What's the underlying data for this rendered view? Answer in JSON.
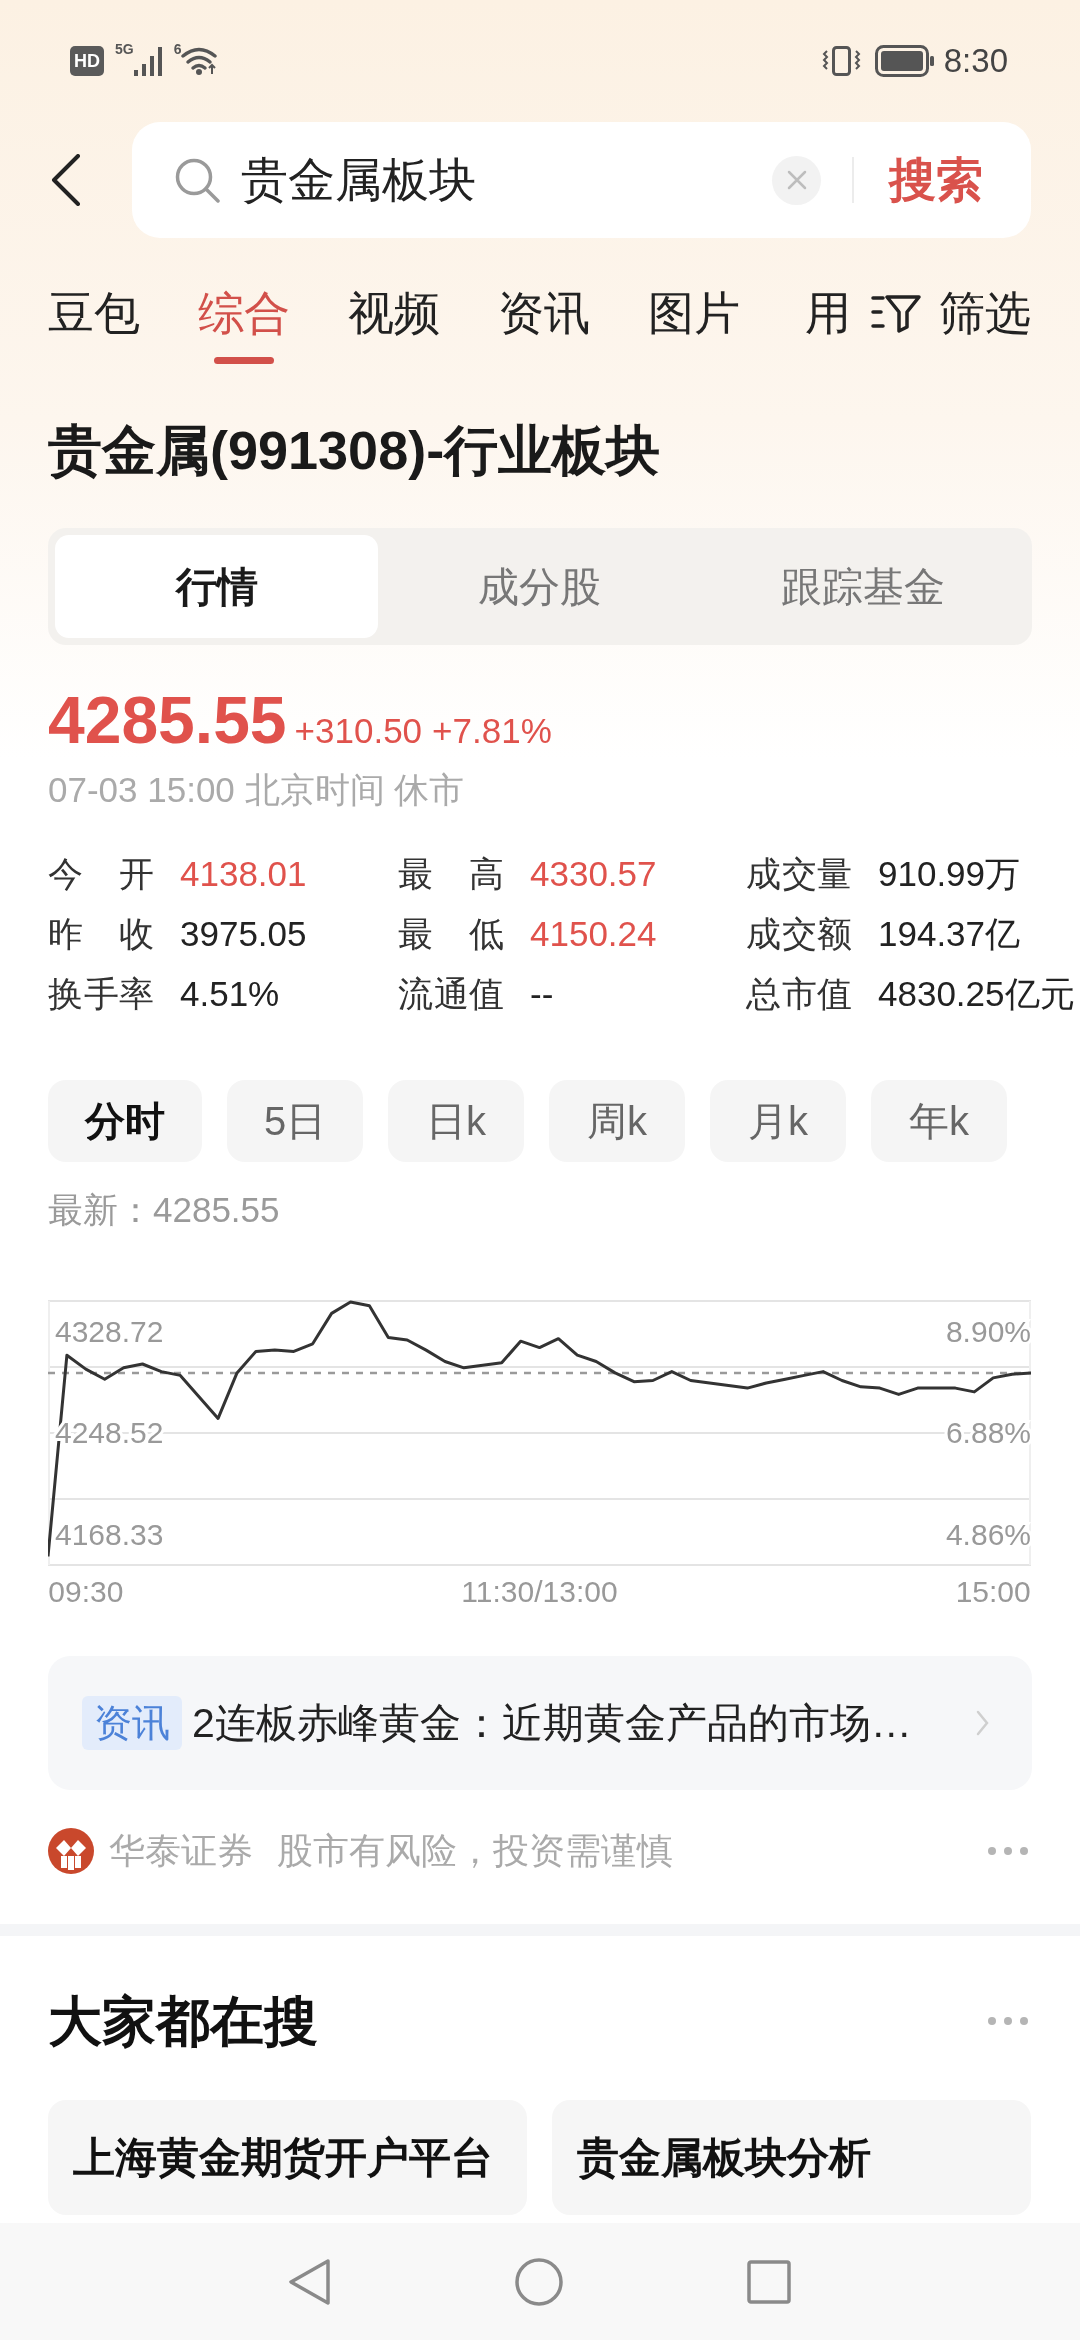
{
  "status_bar": {
    "network_badge": "HD",
    "signal_label": "5G",
    "wifi_label": "6",
    "time": "8:30"
  },
  "search": {
    "value": "贵金属板块",
    "button": "搜索"
  },
  "tabs": [
    {
      "label": "豆包",
      "selected": false
    },
    {
      "label": "综合",
      "selected": true
    },
    {
      "label": "视频",
      "selected": false
    },
    {
      "label": "资讯",
      "selected": false
    },
    {
      "label": "图片",
      "selected": false
    },
    {
      "label": "用",
      "selected": false
    }
  ],
  "filter": {
    "label": "筛选"
  },
  "title": "贵金属(991308)-行业板块",
  "segments": [
    {
      "label": "行情",
      "selected": true
    },
    {
      "label": "成分股",
      "selected": false
    },
    {
      "label": "跟踪基金",
      "selected": false
    }
  ],
  "quote": {
    "price": "4285.55",
    "change": "+310.50",
    "change_percent": "+7.81%",
    "time": "07-03 15:00 北京时间 休市"
  },
  "stats": [
    {
      "cells": [
        {
          "label": "今 开",
          "value": "4138.01",
          "color": "#e0524c"
        },
        {
          "label": "最 高",
          "value": "4330.57",
          "color": "#e0524c"
        },
        {
          "label": "成交量",
          "value": "910.99万",
          "color": "#222222"
        }
      ]
    },
    {
      "cells": [
        {
          "label": "昨 收",
          "value": "3975.05",
          "color": "#222222"
        },
        {
          "label": "最 低",
          "value": "4150.24",
          "color": "#e0524c"
        },
        {
          "label": "成交额",
          "value": "194.37亿",
          "color": "#222222"
        }
      ]
    },
    {
      "cells": [
        {
          "label": "换手率",
          "value": "4.51%",
          "color": "#222222"
        },
        {
          "label": "流通值",
          "value": "--",
          "color": "#222222"
        },
        {
          "label": "总市值",
          "value": "4830.25亿元",
          "color": "#222222"
        }
      ]
    }
  ],
  "periods": [
    {
      "label": "分时",
      "selected": true
    },
    {
      "label": "5日",
      "selected": false
    },
    {
      "label": "日k",
      "selected": false
    },
    {
      "label": "周k",
      "selected": false
    },
    {
      "label": "月k",
      "selected": false
    },
    {
      "label": "年k",
      "selected": false
    }
  ],
  "chart": {
    "latest": "最新：4285.55",
    "right_axis_labels": [
      "8.90%",
      "6.88%",
      "4.86%"
    ],
    "chart_data": {
      "type": "line",
      "categories": [
        null,
        null,
        "09:30",
        null,
        null,
        null,
        null,
        null,
        null,
        null,
        null,
        null,
        null,
        null,
        null,
        null,
        null,
        null,
        null,
        null,
        null,
        null,
        null,
        null,
        null,
        null,
        "11:30/13:00",
        null,
        null,
        null,
        null,
        null,
        null,
        null,
        null,
        null,
        null,
        null,
        null,
        null,
        null,
        null,
        null,
        null,
        null,
        null,
        null,
        null,
        null,
        null,
        "15:00",
        null,
        null
      ],
      "ylim": [
        4146.2,
        4354.8
      ],
      "yticks": [
        {
          "value": 4328.72,
          "label": "4328.72"
        },
        {
          "value": 4248.52,
          "label": "4248.52"
        },
        {
          "value": 4168.33,
          "label": "4168.33"
        }
      ],
      "series": [
        {
          "color": "#333333",
          "values": [
            4153,
            4312,
            4301,
            4293,
            4302,
            4305,
            4299,
            4296,
            4279,
            4262,
            4298,
            4315,
            4316,
            4315,
            4321,
            4345,
            4354,
            4351,
            4326,
            4324,
            4316,
            4307,
            4302,
            4304,
            4306,
            4323,
            4318,
            4325,
            4312,
            4307,
            4298,
            4291,
            4292,
            4299,
            4292,
            4290,
            4288,
            4286,
            4290,
            4293,
            4296,
            4299,
            4292,
            4287,
            4286,
            4281,
            4286,
            4286,
            4286,
            4283,
            4294,
            4297,
            4298
          ]
        }
      ],
      "ref_lines": [
        {
          "axis": "y",
          "value": 4298
        }
      ]
    }
  },
  "news": {
    "tag": "资讯",
    "text": "2连板赤峰黄金：近期黄金产品的市场…"
  },
  "sponsor": {
    "name": "华泰证券",
    "notice": "股市有风险，投资需谨慎"
  },
  "popular": {
    "title": "大家都在搜",
    "items": [
      "上海黄金期货开户平台",
      "贵金属板块分析"
    ]
  }
}
